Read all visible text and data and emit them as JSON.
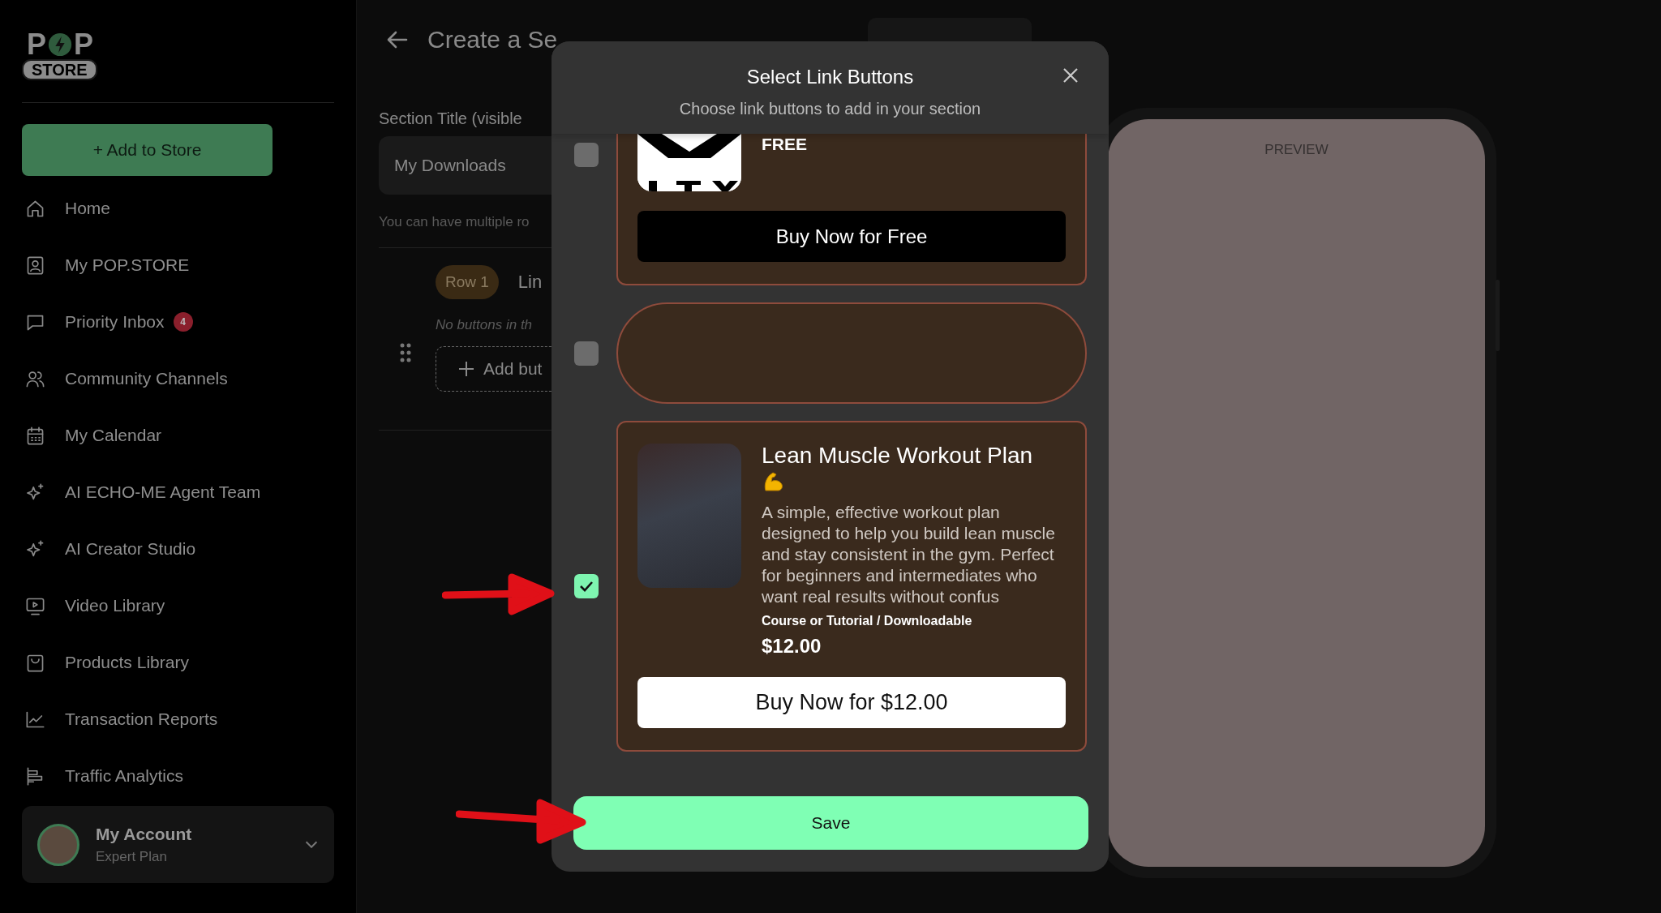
{
  "logo": {
    "left": "P",
    "right": "P",
    "badge": "STORE"
  },
  "sidebar": {
    "add_button": "+ Add to Store",
    "items": [
      {
        "label": "Home"
      },
      {
        "label": "My POP.STORE"
      },
      {
        "label": "Priority Inbox",
        "badge": "4"
      },
      {
        "label": "Community Channels"
      },
      {
        "label": "My Calendar"
      },
      {
        "label": "AI ECHO-ME Agent Team"
      },
      {
        "label": "AI Creator Studio"
      },
      {
        "label": "Video Library"
      },
      {
        "label": "Products Library"
      },
      {
        "label": "Transaction Reports"
      },
      {
        "label": "Traffic Analytics"
      }
    ],
    "account": {
      "name": "My Account",
      "plan": "Expert Plan"
    }
  },
  "page": {
    "title": "Create a Se",
    "section_title_label": "Section Title (visible",
    "section_title_value": "My Downloads",
    "hint": "You can have multiple ro",
    "row": {
      "badge": "Row 1",
      "label": "Lin",
      "empty_text": "No buttons in th",
      "add_button": "Add but"
    }
  },
  "modal": {
    "title": "Select Link Buttons",
    "subtitle": "Choose link buttons to add in your section",
    "items": [
      {
        "kind": "product-cut",
        "checked": false,
        "price": "FREE",
        "button": "Buy Now for Free"
      },
      {
        "kind": "empty",
        "checked": false
      },
      {
        "kind": "product",
        "checked": true,
        "title": "Lean Muscle Workout Plan",
        "description": "A simple, effective workout plan designed to help you build lean muscle and stay consistent in the gym. Perfect for beginners and intermediates who want real results without confus",
        "category": "Course or Tutorial / Downloadable",
        "price": "$12.00",
        "button": "Buy Now for $12.00"
      }
    ],
    "save": "Save"
  },
  "preview": {
    "label": "PREVIEW"
  }
}
